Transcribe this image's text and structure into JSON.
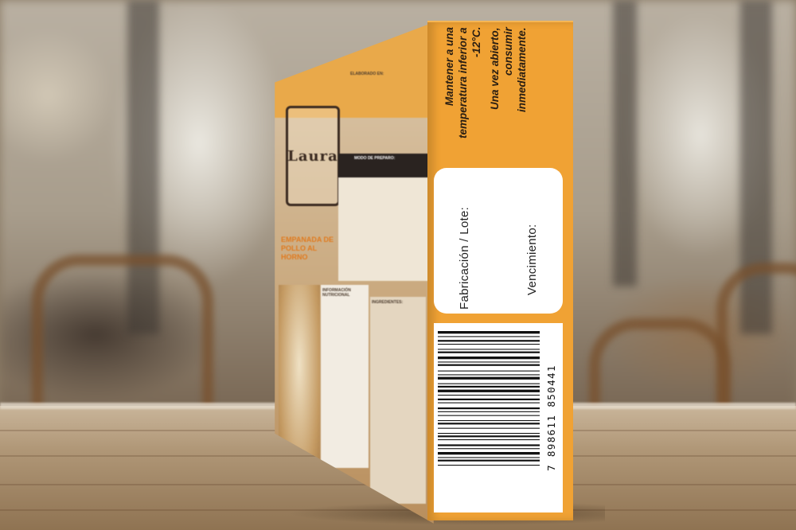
{
  "scene": {
    "description_colors": {
      "box_orange": "#f0a234",
      "table_wood": "#b09777"
    }
  },
  "box": {
    "brand": "Laura",
    "front_header": "ELABORADO EN:",
    "front_section": "MODO DE PREPARO:",
    "product_name": "EMPANADA DE POLLO AL HORNO",
    "nutrition_title": "INFORMACIÓN NUTRICIONAL",
    "ingredients_title": "INGREDIENTES:",
    "side": {
      "storage_note": "Mantener a una temperatura inferior a -12°C.",
      "open_note": "Una vez abierto, consumir inmediatamente.",
      "lot_label": "Fabricación / Lote:",
      "expiry_label": "Vencimiento:",
      "barcode_digits": "7 898611 850441"
    }
  }
}
